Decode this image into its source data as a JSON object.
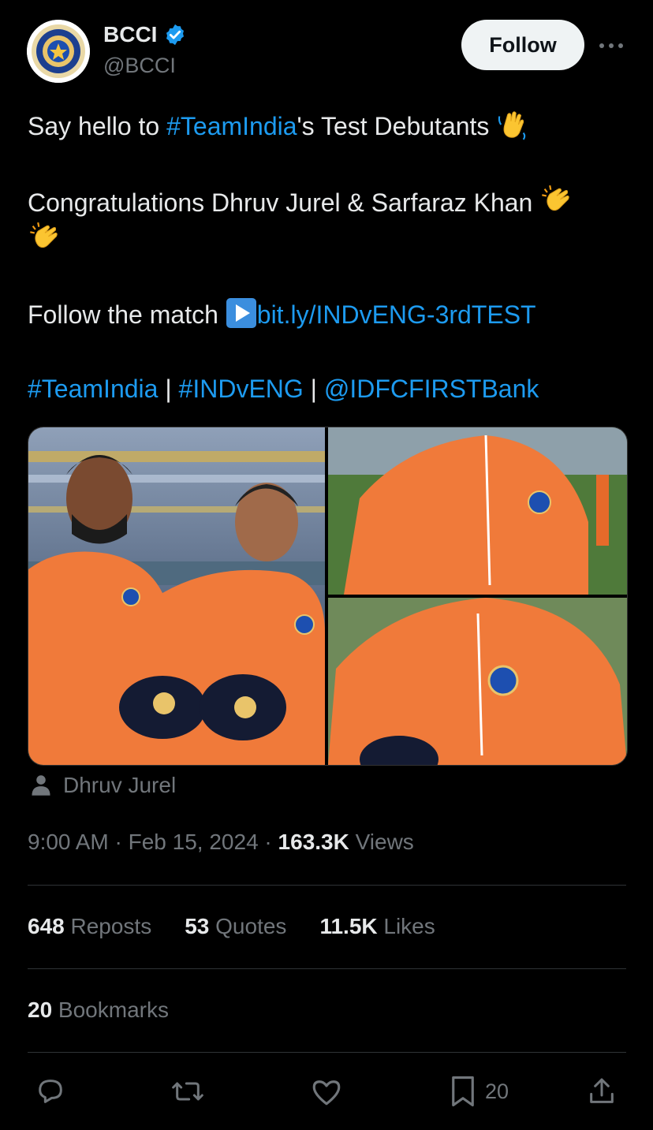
{
  "author": {
    "name": "BCCI",
    "handle": "@BCCI",
    "verified": true,
    "verified_color": "#1d9bf0"
  },
  "follow_label": "Follow",
  "tweet": {
    "line1": {
      "pre": "Say hello to ",
      "hashtag": "#TeamIndia",
      "post": "'s Test Debutants",
      "emoji": "waving-hand"
    },
    "line2": {
      "text": "Congratulations Dhruv Jurel & Sarfaraz Khan",
      "emoji": "clapping-hands"
    },
    "line4": {
      "pre": "Follow the match",
      "link": "bit.ly/INDvENG-3rdTEST",
      "emoji": "play-button"
    },
    "line5": {
      "tag1": "#TeamIndia",
      "sep1": " | ",
      "tag2": "#INDvENG",
      "sep2": " | ",
      "tag3": "@IDFCFIRSTBank"
    }
  },
  "media_tag": "Dhruv Jurel",
  "timestamp": {
    "time": "9:00 AM",
    "sep1": " · ",
    "date": "Feb 15, 2024",
    "sep2": " · ",
    "views_count": "163.3K",
    "views_label": " Views"
  },
  "stats": {
    "reposts_count": "648",
    "reposts_label": " Reposts",
    "quotes_count": "53",
    "quotes_label": " Quotes",
    "likes_count": "11.5K",
    "likes_label": " Likes",
    "bookmarks_count": "20",
    "bookmarks_label": " Bookmarks"
  },
  "actions": {
    "reply_icon": "reply-icon",
    "repost_icon": "repost-icon",
    "like_icon": "like-icon",
    "bookmark_icon": "bookmark-icon",
    "bookmark_count": "20",
    "share_icon": "share-icon"
  },
  "colors": {
    "background": "#000000",
    "text": "#e7e9ea",
    "secondary": "#71767b",
    "link": "#1d9bf0",
    "jersey": "#f07a3a"
  }
}
